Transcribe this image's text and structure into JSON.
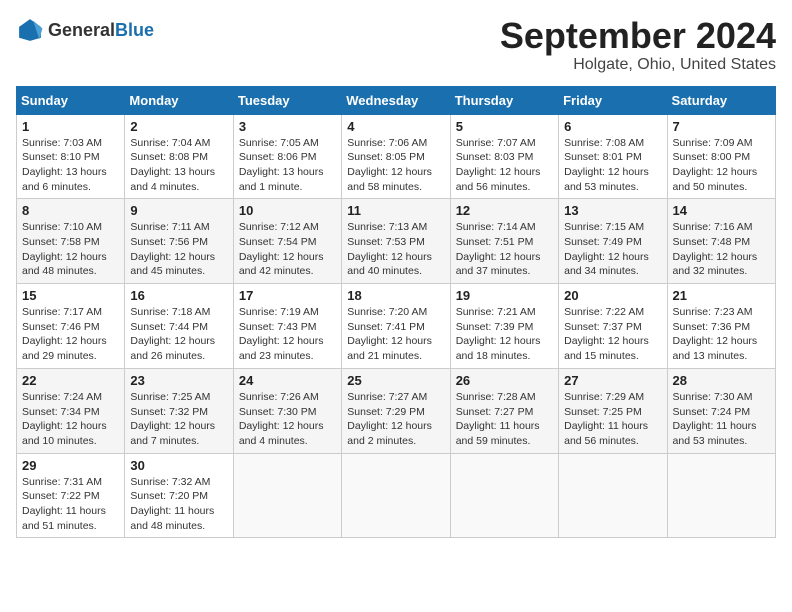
{
  "logo": {
    "general": "General",
    "blue": "Blue"
  },
  "title": "September 2024",
  "location": "Holgate, Ohio, United States",
  "days_of_week": [
    "Sunday",
    "Monday",
    "Tuesday",
    "Wednesday",
    "Thursday",
    "Friday",
    "Saturday"
  ],
  "weeks": [
    [
      {
        "day": "1",
        "sunrise": "Sunrise: 7:03 AM",
        "sunset": "Sunset: 8:10 PM",
        "daylight": "Daylight: 13 hours and 6 minutes."
      },
      {
        "day": "2",
        "sunrise": "Sunrise: 7:04 AM",
        "sunset": "Sunset: 8:08 PM",
        "daylight": "Daylight: 13 hours and 4 minutes."
      },
      {
        "day": "3",
        "sunrise": "Sunrise: 7:05 AM",
        "sunset": "Sunset: 8:06 PM",
        "daylight": "Daylight: 13 hours and 1 minute."
      },
      {
        "day": "4",
        "sunrise": "Sunrise: 7:06 AM",
        "sunset": "Sunset: 8:05 PM",
        "daylight": "Daylight: 12 hours and 58 minutes."
      },
      {
        "day": "5",
        "sunrise": "Sunrise: 7:07 AM",
        "sunset": "Sunset: 8:03 PM",
        "daylight": "Daylight: 12 hours and 56 minutes."
      },
      {
        "day": "6",
        "sunrise": "Sunrise: 7:08 AM",
        "sunset": "Sunset: 8:01 PM",
        "daylight": "Daylight: 12 hours and 53 minutes."
      },
      {
        "day": "7",
        "sunrise": "Sunrise: 7:09 AM",
        "sunset": "Sunset: 8:00 PM",
        "daylight": "Daylight: 12 hours and 50 minutes."
      }
    ],
    [
      {
        "day": "8",
        "sunrise": "Sunrise: 7:10 AM",
        "sunset": "Sunset: 7:58 PM",
        "daylight": "Daylight: 12 hours and 48 minutes."
      },
      {
        "day": "9",
        "sunrise": "Sunrise: 7:11 AM",
        "sunset": "Sunset: 7:56 PM",
        "daylight": "Daylight: 12 hours and 45 minutes."
      },
      {
        "day": "10",
        "sunrise": "Sunrise: 7:12 AM",
        "sunset": "Sunset: 7:54 PM",
        "daylight": "Daylight: 12 hours and 42 minutes."
      },
      {
        "day": "11",
        "sunrise": "Sunrise: 7:13 AM",
        "sunset": "Sunset: 7:53 PM",
        "daylight": "Daylight: 12 hours and 40 minutes."
      },
      {
        "day": "12",
        "sunrise": "Sunrise: 7:14 AM",
        "sunset": "Sunset: 7:51 PM",
        "daylight": "Daylight: 12 hours and 37 minutes."
      },
      {
        "day": "13",
        "sunrise": "Sunrise: 7:15 AM",
        "sunset": "Sunset: 7:49 PM",
        "daylight": "Daylight: 12 hours and 34 minutes."
      },
      {
        "day": "14",
        "sunrise": "Sunrise: 7:16 AM",
        "sunset": "Sunset: 7:48 PM",
        "daylight": "Daylight: 12 hours and 32 minutes."
      }
    ],
    [
      {
        "day": "15",
        "sunrise": "Sunrise: 7:17 AM",
        "sunset": "Sunset: 7:46 PM",
        "daylight": "Daylight: 12 hours and 29 minutes."
      },
      {
        "day": "16",
        "sunrise": "Sunrise: 7:18 AM",
        "sunset": "Sunset: 7:44 PM",
        "daylight": "Daylight: 12 hours and 26 minutes."
      },
      {
        "day": "17",
        "sunrise": "Sunrise: 7:19 AM",
        "sunset": "Sunset: 7:43 PM",
        "daylight": "Daylight: 12 hours and 23 minutes."
      },
      {
        "day": "18",
        "sunrise": "Sunrise: 7:20 AM",
        "sunset": "Sunset: 7:41 PM",
        "daylight": "Daylight: 12 hours and 21 minutes."
      },
      {
        "day": "19",
        "sunrise": "Sunrise: 7:21 AM",
        "sunset": "Sunset: 7:39 PM",
        "daylight": "Daylight: 12 hours and 18 minutes."
      },
      {
        "day": "20",
        "sunrise": "Sunrise: 7:22 AM",
        "sunset": "Sunset: 7:37 PM",
        "daylight": "Daylight: 12 hours and 15 minutes."
      },
      {
        "day": "21",
        "sunrise": "Sunrise: 7:23 AM",
        "sunset": "Sunset: 7:36 PM",
        "daylight": "Daylight: 12 hours and 13 minutes."
      }
    ],
    [
      {
        "day": "22",
        "sunrise": "Sunrise: 7:24 AM",
        "sunset": "Sunset: 7:34 PM",
        "daylight": "Daylight: 12 hours and 10 minutes."
      },
      {
        "day": "23",
        "sunrise": "Sunrise: 7:25 AM",
        "sunset": "Sunset: 7:32 PM",
        "daylight": "Daylight: 12 hours and 7 minutes."
      },
      {
        "day": "24",
        "sunrise": "Sunrise: 7:26 AM",
        "sunset": "Sunset: 7:30 PM",
        "daylight": "Daylight: 12 hours and 4 minutes."
      },
      {
        "day": "25",
        "sunrise": "Sunrise: 7:27 AM",
        "sunset": "Sunset: 7:29 PM",
        "daylight": "Daylight: 12 hours and 2 minutes."
      },
      {
        "day": "26",
        "sunrise": "Sunrise: 7:28 AM",
        "sunset": "Sunset: 7:27 PM",
        "daylight": "Daylight: 11 hours and 59 minutes."
      },
      {
        "day": "27",
        "sunrise": "Sunrise: 7:29 AM",
        "sunset": "Sunset: 7:25 PM",
        "daylight": "Daylight: 11 hours and 56 minutes."
      },
      {
        "day": "28",
        "sunrise": "Sunrise: 7:30 AM",
        "sunset": "Sunset: 7:24 PM",
        "daylight": "Daylight: 11 hours and 53 minutes."
      }
    ],
    [
      {
        "day": "29",
        "sunrise": "Sunrise: 7:31 AM",
        "sunset": "Sunset: 7:22 PM",
        "daylight": "Daylight: 11 hours and 51 minutes."
      },
      {
        "day": "30",
        "sunrise": "Sunrise: 7:32 AM",
        "sunset": "Sunset: 7:20 PM",
        "daylight": "Daylight: 11 hours and 48 minutes."
      },
      null,
      null,
      null,
      null,
      null
    ]
  ]
}
